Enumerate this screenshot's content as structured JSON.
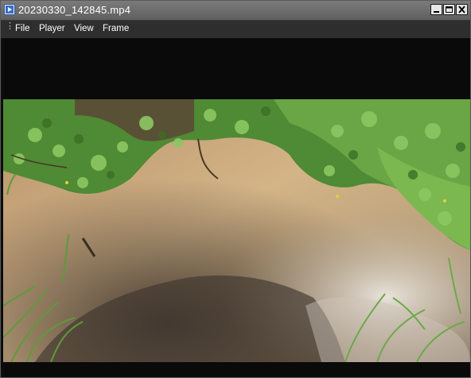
{
  "window": {
    "title": "20230330_142845.mp4",
    "controls": {
      "minimize_icon": "minimize-icon",
      "maximize_icon": "maximize-icon",
      "close_icon": "close-icon"
    }
  },
  "menubar": {
    "items": [
      {
        "label": "File"
      },
      {
        "label": "Player"
      },
      {
        "label": "View"
      },
      {
        "label": "Frame"
      }
    ]
  },
  "video_frame": {
    "scene": "muddy stream with green vegetation",
    "colors": {
      "water": "#c9a77a",
      "foliage": "#5e9a3c",
      "letterbox": "#0a0a0a"
    }
  }
}
